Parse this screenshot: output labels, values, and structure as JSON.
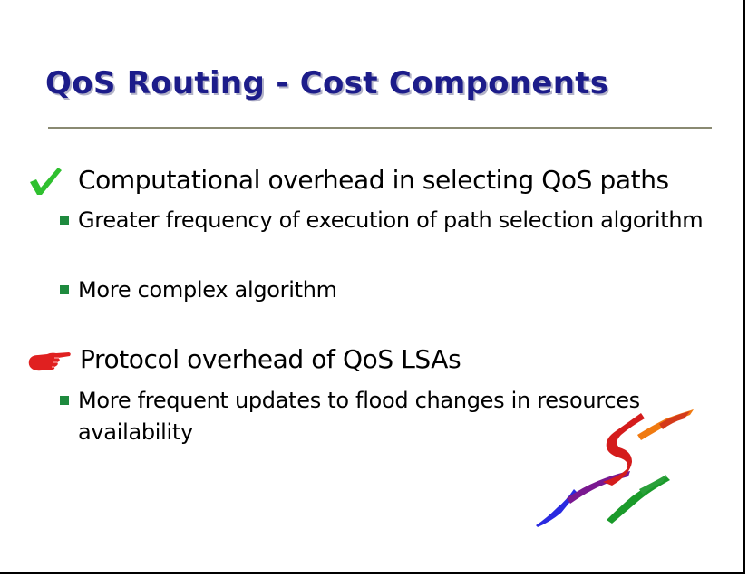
{
  "title": "QoS Routing - Cost Components",
  "sections": [
    {
      "icon": "check-icon",
      "heading": "Computational overhead in selecting QoS paths",
      "items": [
        "Greater frequency of execution of path selection algorithm",
        "More complex algorithm"
      ]
    },
    {
      "icon": "pointing-hand-icon",
      "heading": "Protocol overhead of QoS LSAs",
      "items": [
        "More frequent updates to flood changes in resources availability"
      ]
    }
  ],
  "colors": {
    "title": "#1c1c8a",
    "bullet_square": "#1e8a3e",
    "check": "#2fc02f",
    "hand": "#e02020"
  },
  "logo": "brush-stroke-logo"
}
